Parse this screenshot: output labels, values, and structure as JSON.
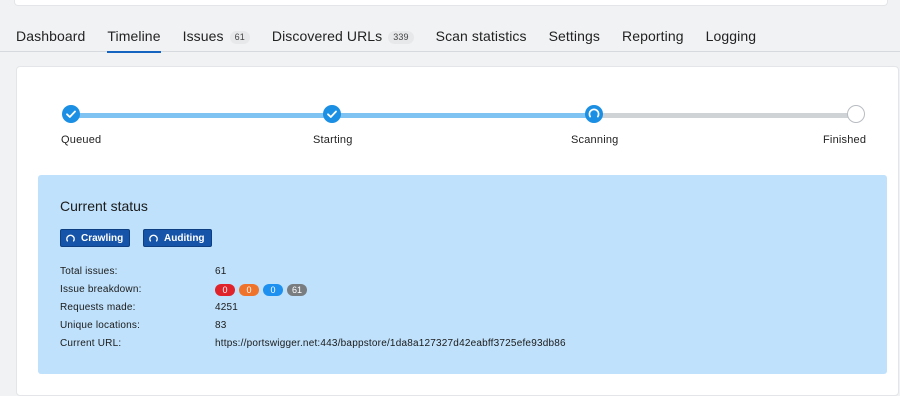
{
  "tabs": [
    {
      "label": "Dashboard",
      "count": null
    },
    {
      "label": "Timeline",
      "count": null
    },
    {
      "label": "Issues",
      "count": "61"
    },
    {
      "label": "Discovered URLs",
      "count": "339"
    },
    {
      "label": "Scan statistics",
      "count": null
    },
    {
      "label": "Settings",
      "count": null
    },
    {
      "label": "Reporting",
      "count": null
    },
    {
      "label": "Logging",
      "count": null
    }
  ],
  "active_tab": "Timeline",
  "progress": {
    "steps": [
      {
        "label": "Queued",
        "state": "done",
        "icon": "check-icon"
      },
      {
        "label": "Starting",
        "state": "done",
        "icon": "check-icon"
      },
      {
        "label": "Scanning",
        "state": "active",
        "icon": "spinner-icon"
      },
      {
        "label": "Finished",
        "state": "pending",
        "icon": "empty-circle-icon"
      }
    ]
  },
  "status": {
    "title": "Current status",
    "chips": [
      {
        "label": "Crawling",
        "icon": "spinner-icon"
      },
      {
        "label": "Auditing",
        "icon": "spinner-icon"
      }
    ],
    "fields": {
      "total_issues_label": "Total issues:",
      "total_issues": "61",
      "breakdown_label": "Issue breakdown:",
      "breakdown": [
        {
          "value": "0",
          "color": "#e0232b"
        },
        {
          "value": "0",
          "color": "#f0732b"
        },
        {
          "value": "0",
          "color": "#1e90f0"
        },
        {
          "value": "61",
          "color": "#7a7d80"
        }
      ],
      "requests_label": "Requests made:",
      "requests": "4251",
      "locations_label": "Unique locations:",
      "locations": "83",
      "url_label": "Current URL:",
      "url": "https://portswigger.net:443/bappstore/1da8a127327d42eabff3725efe93db86"
    }
  },
  "colors": {
    "accent": "#1a8fe3",
    "status_bg": "#bfe1fb",
    "chip_bg": "#1554a8",
    "active_tab_underline": "#1565c0"
  }
}
